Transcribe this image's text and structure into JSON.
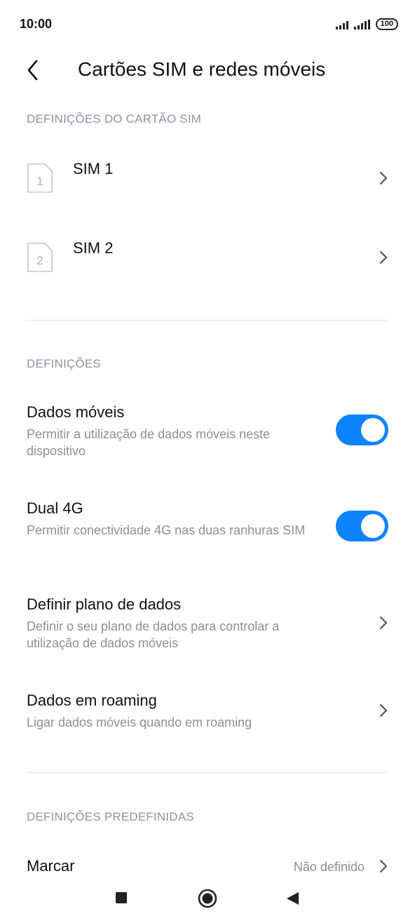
{
  "status_bar": {
    "time": "10:00",
    "battery": "100"
  },
  "header": {
    "title": "Cartões SIM e redes móveis"
  },
  "sim_section": {
    "header": "DEFINIÇÕES DO CARTÃO SIM",
    "sims": [
      {
        "label": "SIM 1",
        "icon_number": "1"
      },
      {
        "label": "SIM 2",
        "icon_number": "2"
      }
    ]
  },
  "settings_section": {
    "header": "DEFINIÇÕES",
    "items": [
      {
        "title": "Dados móveis",
        "description": "Permitir a utilização de dados móveis neste dispositivo",
        "control": "toggle",
        "state": "on"
      },
      {
        "title": "Dual 4G",
        "description": "Permitir conectividade 4G nas duas ranhuras SIM",
        "control": "toggle",
        "state": "on"
      },
      {
        "title": "Definir plano de dados",
        "description": "Definir o seu plano de dados para controlar a utilização de dados móveis",
        "control": "chevron"
      },
      {
        "title": "Dados em roaming",
        "description": "Ligar dados móveis quando em roaming",
        "control": "chevron"
      }
    ]
  },
  "defaults_section": {
    "header": "DEFINIÇÕES PREDEFINIDAS",
    "items": [
      {
        "title": "Marcar",
        "value": "Não definido"
      }
    ]
  },
  "colors": {
    "accent": "#0d84ff",
    "section_header": "#8a93a8",
    "secondary_text": "#8f8f8f"
  },
  "nav_bar": {
    "icons": [
      "recents-square-icon",
      "home-circle-icon",
      "back-triangle-icon"
    ]
  }
}
